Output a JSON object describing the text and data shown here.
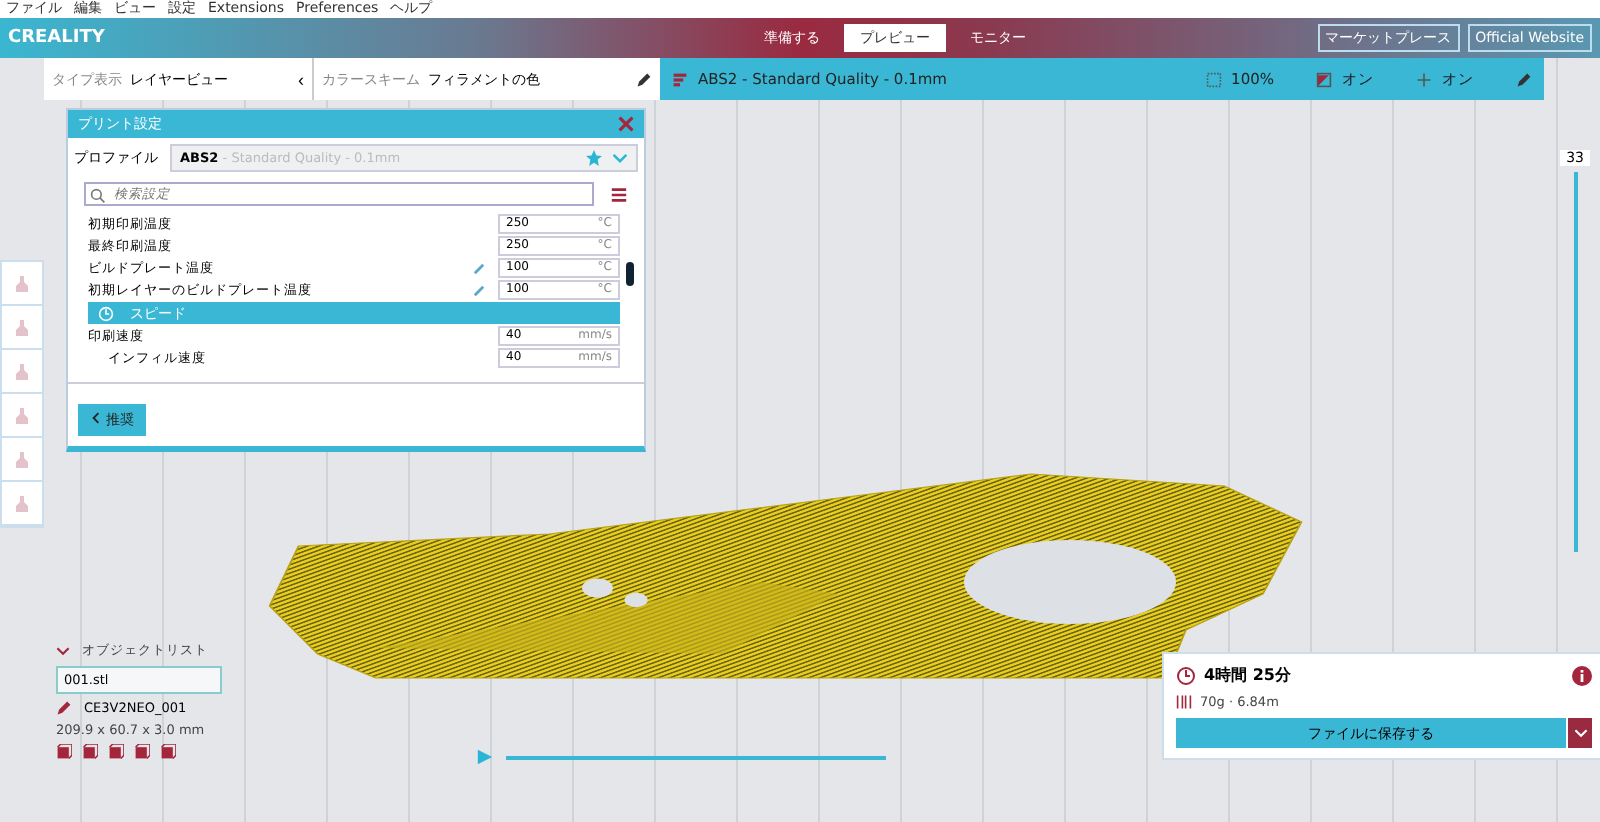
{
  "menu_bar": [
    "ファイル",
    "編集",
    "ビュー",
    "設定",
    "Extensions",
    "Preferences",
    "ヘルプ"
  ],
  "header": {
    "logo": "CREALITY",
    "tabs": [
      {
        "label": "準備する",
        "selected": false
      },
      {
        "label": "プレビュー",
        "selected": true
      },
      {
        "label": "モニター",
        "selected": false
      }
    ],
    "links": [
      "マーケットプレース",
      "Official Website"
    ]
  },
  "view_bar": {
    "view_type_label": "タイプ表示",
    "view_type_value": "レイヤービュー",
    "collapse": "‹",
    "color_scheme_label": "カラースキーム",
    "color_scheme_value": "フィラメントの色"
  },
  "profile_bar": {
    "profile": "ABS2 - Standard Quality - 0.1mm",
    "infill": "100%",
    "support": "オン",
    "adhesion": "オン"
  },
  "print_settings": {
    "title": "プリント設定",
    "profile_label": "プロファイル",
    "profile_name": "ABS2",
    "profile_detail": "- Standard Quality - 0.1mm",
    "search_placeholder": "検索設定",
    "rows": [
      {
        "kind": "setting",
        "label": "初期印刷温度",
        "value": "250",
        "unit": "°C",
        "linked": false
      },
      {
        "kind": "setting",
        "label": "最終印刷温度",
        "value": "250",
        "unit": "°C",
        "linked": false
      },
      {
        "kind": "setting",
        "label": "ビルドプレート温度",
        "value": "100",
        "unit": "°C",
        "linked": true
      },
      {
        "kind": "setting",
        "label": "初期レイヤーのビルドプレート温度",
        "value": "100",
        "unit": "°C",
        "linked": true
      },
      {
        "kind": "category",
        "label": "スピード"
      },
      {
        "kind": "setting",
        "label": "印刷速度",
        "value": "40",
        "unit": "mm/s",
        "linked": false
      },
      {
        "kind": "subsetting",
        "label": "インフィル速度",
        "value": "40",
        "unit": "mm/s",
        "linked": false
      }
    ],
    "recommended_button": "推奨"
  },
  "layer_slider": {
    "value": "33",
    "level": 1
  },
  "object_list": {
    "title": "オブジェクトリスト",
    "file": "001.stl",
    "name": "CE3V2NEO_001",
    "dimensions": "209.9 x 60.7 x 3.0 mm"
  },
  "estimate": {
    "time": "4時間 25分",
    "material": "70g · 6.84m",
    "save_button": "ファイルに保存する"
  },
  "playback": {
    "level": 1
  }
}
